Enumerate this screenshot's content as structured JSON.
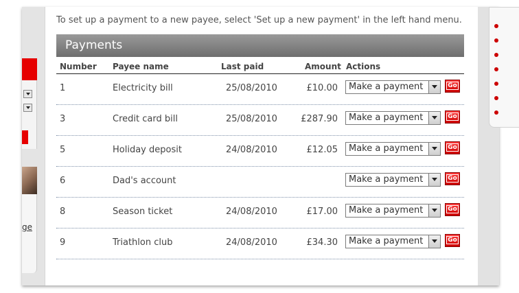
{
  "intro_text": "To set up a payment to a new payee, select 'Set up a new payment' in the left hand menu.",
  "section_title": "Payments",
  "columns": {
    "number": "Number",
    "payee": "Payee name",
    "last_paid": "Last paid",
    "amount": "Amount",
    "actions": "Actions"
  },
  "rows": [
    {
      "number": "1",
      "payee": "Electricity bill",
      "last_paid": "25/08/2010",
      "amount": "£10.00",
      "action": "Make a payment",
      "go": "Go"
    },
    {
      "number": "3",
      "payee": "Credit card bill",
      "last_paid": "25/08/2010",
      "amount": "£287.90",
      "action": "Make a payment",
      "go": "Go"
    },
    {
      "number": "5",
      "payee": "Holiday deposit",
      "last_paid": "24/08/2010",
      "amount": "£12.05",
      "action": "Make a payment",
      "go": "Go"
    },
    {
      "number": "6",
      "payee": "Dad's account",
      "last_paid": "",
      "amount": "",
      "action": "Make a payment",
      "go": "Go"
    },
    {
      "number": "8",
      "payee": "Season ticket",
      "last_paid": "24/08/2010",
      "amount": "£17.00",
      "action": "Make a payment",
      "go": "Go"
    },
    {
      "number": "9",
      "payee": "Triathlon club",
      "last_paid": "24/08/2010",
      "amount": "£34.30",
      "action": "Make a payment",
      "go": "Go"
    }
  ],
  "left_panel": {
    "link_fragment": "ge"
  },
  "colors": {
    "accent_red": "#e60000",
    "header_gray": "#808080"
  }
}
